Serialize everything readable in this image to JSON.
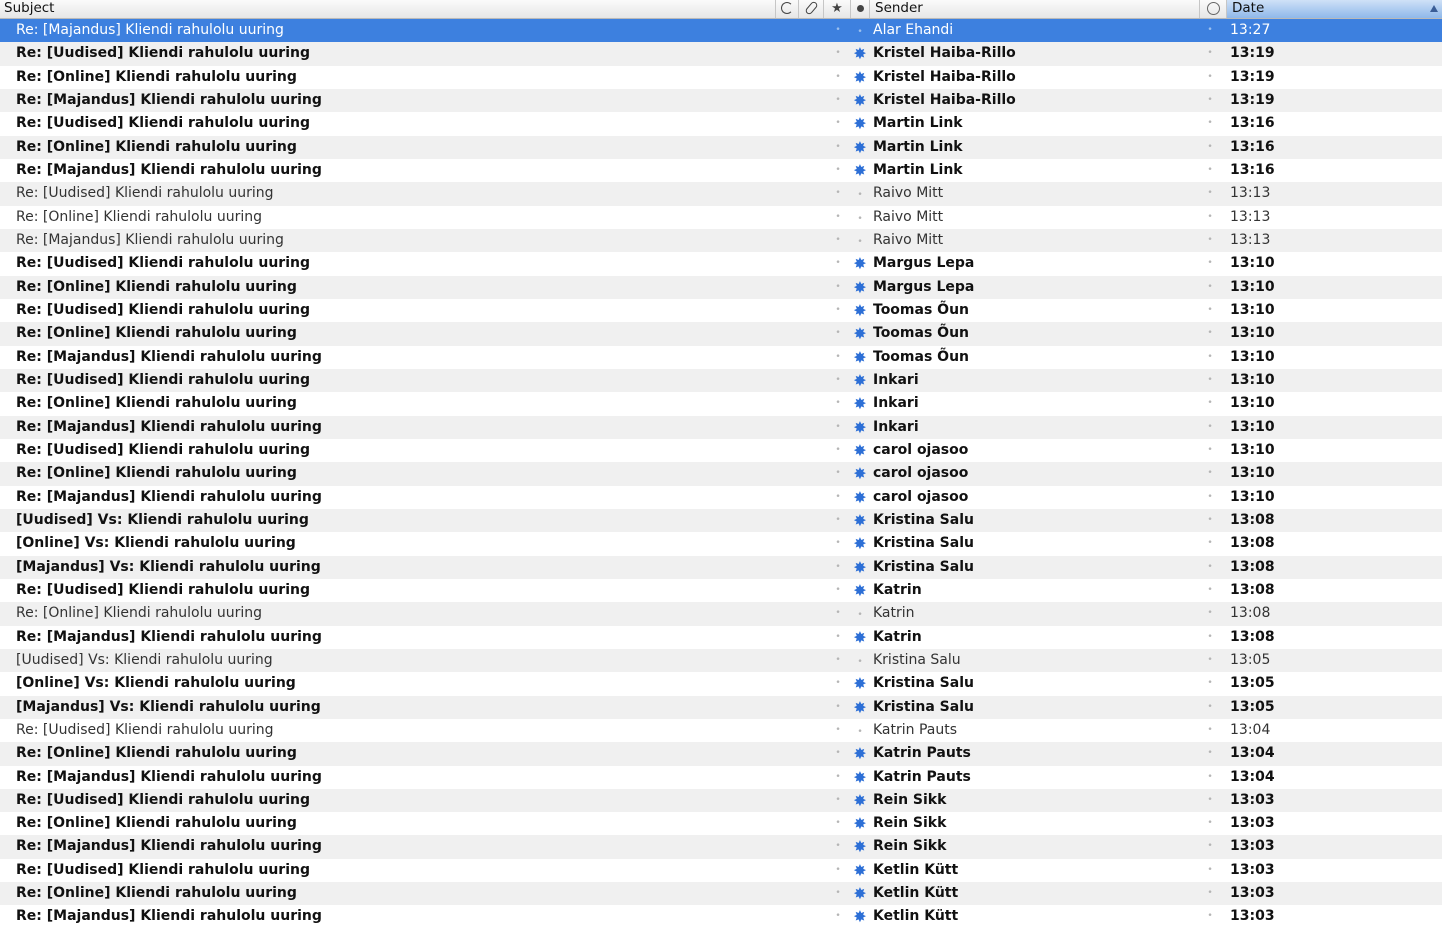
{
  "columns": {
    "subject": "Subject",
    "sender": "Sender",
    "date": "Date",
    "thread_icon": "thread-icon",
    "attachment_icon": "paperclip-icon",
    "star_icon": "star-icon",
    "read_icon": "read-status-dot-icon",
    "junk_icon": "junk-icon"
  },
  "sort": {
    "column": "Date",
    "direction": "ascending"
  },
  "colors": {
    "selection": "#3d80df",
    "unread_star": "#2d6fd6",
    "date_header": "#8fb8ea"
  },
  "messages": [
    {
      "subject": "Re: [Majandus] Kliendi rahulolu uuring",
      "sender": "Alar Ehandi",
      "date": "13:27",
      "unread": false,
      "selected": true
    },
    {
      "subject": "Re: [Uudised] Kliendi rahulolu uuring",
      "sender": "Kristel Haiba-Rillo",
      "date": "13:19",
      "unread": true,
      "selected": false
    },
    {
      "subject": "Re: [Online] Kliendi rahulolu uuring",
      "sender": "Kristel Haiba-Rillo",
      "date": "13:19",
      "unread": true,
      "selected": false
    },
    {
      "subject": "Re: [Majandus] Kliendi rahulolu uuring",
      "sender": "Kristel Haiba-Rillo",
      "date": "13:19",
      "unread": true,
      "selected": false
    },
    {
      "subject": "Re: [Uudised] Kliendi rahulolu uuring",
      "sender": "Martin Link",
      "date": "13:16",
      "unread": true,
      "selected": false
    },
    {
      "subject": "Re: [Online] Kliendi rahulolu uuring",
      "sender": "Martin Link",
      "date": "13:16",
      "unread": true,
      "selected": false
    },
    {
      "subject": "Re: [Majandus] Kliendi rahulolu uuring",
      "sender": "Martin Link",
      "date": "13:16",
      "unread": true,
      "selected": false
    },
    {
      "subject": "Re: [Uudised] Kliendi rahulolu uuring",
      "sender": "Raivo Mitt",
      "date": "13:13",
      "unread": false,
      "selected": false
    },
    {
      "subject": "Re: [Online] Kliendi rahulolu uuring",
      "sender": "Raivo Mitt",
      "date": "13:13",
      "unread": false,
      "selected": false
    },
    {
      "subject": "Re: [Majandus] Kliendi rahulolu uuring",
      "sender": "Raivo Mitt",
      "date": "13:13",
      "unread": false,
      "selected": false
    },
    {
      "subject": "Re: [Uudised] Kliendi rahulolu uuring",
      "sender": "Margus Lepa",
      "date": "13:10",
      "unread": true,
      "selected": false
    },
    {
      "subject": "Re: [Online] Kliendi rahulolu uuring",
      "sender": "Margus Lepa",
      "date": "13:10",
      "unread": true,
      "selected": false
    },
    {
      "subject": "Re: [Uudised] Kliendi rahulolu uuring",
      "sender": "Toomas Õun",
      "date": "13:10",
      "unread": true,
      "selected": false
    },
    {
      "subject": "Re: [Online] Kliendi rahulolu uuring",
      "sender": "Toomas Õun",
      "date": "13:10",
      "unread": true,
      "selected": false
    },
    {
      "subject": "Re: [Majandus] Kliendi rahulolu uuring",
      "sender": "Toomas Õun",
      "date": "13:10",
      "unread": true,
      "selected": false
    },
    {
      "subject": "Re: [Uudised] Kliendi rahulolu uuring",
      "sender": "Inkari",
      "date": "13:10",
      "unread": true,
      "selected": false
    },
    {
      "subject": "Re: [Online] Kliendi rahulolu uuring",
      "sender": "Inkari",
      "date": "13:10",
      "unread": true,
      "selected": false
    },
    {
      "subject": "Re: [Majandus] Kliendi rahulolu uuring",
      "sender": "Inkari",
      "date": "13:10",
      "unread": true,
      "selected": false
    },
    {
      "subject": "Re: [Uudised] Kliendi rahulolu uuring",
      "sender": "carol ojasoo",
      "date": "13:10",
      "unread": true,
      "selected": false
    },
    {
      "subject": "Re: [Online] Kliendi rahulolu uuring",
      "sender": "carol ojasoo",
      "date": "13:10",
      "unread": true,
      "selected": false
    },
    {
      "subject": "Re: [Majandus] Kliendi rahulolu uuring",
      "sender": "carol ojasoo",
      "date": "13:10",
      "unread": true,
      "selected": false
    },
    {
      "subject": "[Uudised] Vs: Kliendi rahulolu uuring",
      "sender": "Kristina Salu",
      "date": "13:08",
      "unread": true,
      "selected": false
    },
    {
      "subject": "[Online] Vs: Kliendi rahulolu uuring",
      "sender": "Kristina Salu",
      "date": "13:08",
      "unread": true,
      "selected": false
    },
    {
      "subject": "[Majandus] Vs: Kliendi rahulolu uuring",
      "sender": "Kristina Salu",
      "date": "13:08",
      "unread": true,
      "selected": false
    },
    {
      "subject": "Re: [Uudised] Kliendi rahulolu uuring",
      "sender": "Katrin",
      "date": "13:08",
      "unread": true,
      "selected": false
    },
    {
      "subject": "Re: [Online] Kliendi rahulolu uuring",
      "sender": "Katrin",
      "date": "13:08",
      "unread": false,
      "selected": false
    },
    {
      "subject": "Re: [Majandus] Kliendi rahulolu uuring",
      "sender": "Katrin",
      "date": "13:08",
      "unread": true,
      "selected": false
    },
    {
      "subject": "[Uudised] Vs: Kliendi rahulolu uuring",
      "sender": "Kristina Salu",
      "date": "13:05",
      "unread": false,
      "selected": false
    },
    {
      "subject": "[Online] Vs: Kliendi rahulolu uuring",
      "sender": "Kristina Salu",
      "date": "13:05",
      "unread": true,
      "selected": false
    },
    {
      "subject": "[Majandus] Vs: Kliendi rahulolu uuring",
      "sender": "Kristina Salu",
      "date": "13:05",
      "unread": true,
      "selected": false
    },
    {
      "subject": "Re: [Uudised] Kliendi rahulolu uuring",
      "sender": "Katrin Pauts",
      "date": "13:04",
      "unread": false,
      "selected": false
    },
    {
      "subject": "Re: [Online] Kliendi rahulolu uuring",
      "sender": "Katrin Pauts",
      "date": "13:04",
      "unread": true,
      "selected": false
    },
    {
      "subject": "Re: [Majandus] Kliendi rahulolu uuring",
      "sender": "Katrin Pauts",
      "date": "13:04",
      "unread": true,
      "selected": false
    },
    {
      "subject": "Re: [Uudised] Kliendi rahulolu uuring",
      "sender": "Rein Sikk",
      "date": "13:03",
      "unread": true,
      "selected": false
    },
    {
      "subject": "Re: [Online] Kliendi rahulolu uuring",
      "sender": "Rein Sikk",
      "date": "13:03",
      "unread": true,
      "selected": false
    },
    {
      "subject": "Re: [Majandus] Kliendi rahulolu uuring",
      "sender": "Rein Sikk",
      "date": "13:03",
      "unread": true,
      "selected": false
    },
    {
      "subject": "Re: [Uudised] Kliendi rahulolu uuring",
      "sender": "Ketlin Kütt",
      "date": "13:03",
      "unread": true,
      "selected": false
    },
    {
      "subject": "Re: [Online] Kliendi rahulolu uuring",
      "sender": "Ketlin Kütt",
      "date": "13:03",
      "unread": true,
      "selected": false
    },
    {
      "subject": "Re: [Majandus] Kliendi rahulolu uuring",
      "sender": "Ketlin Kütt",
      "date": "13:03",
      "unread": true,
      "selected": false
    }
  ]
}
